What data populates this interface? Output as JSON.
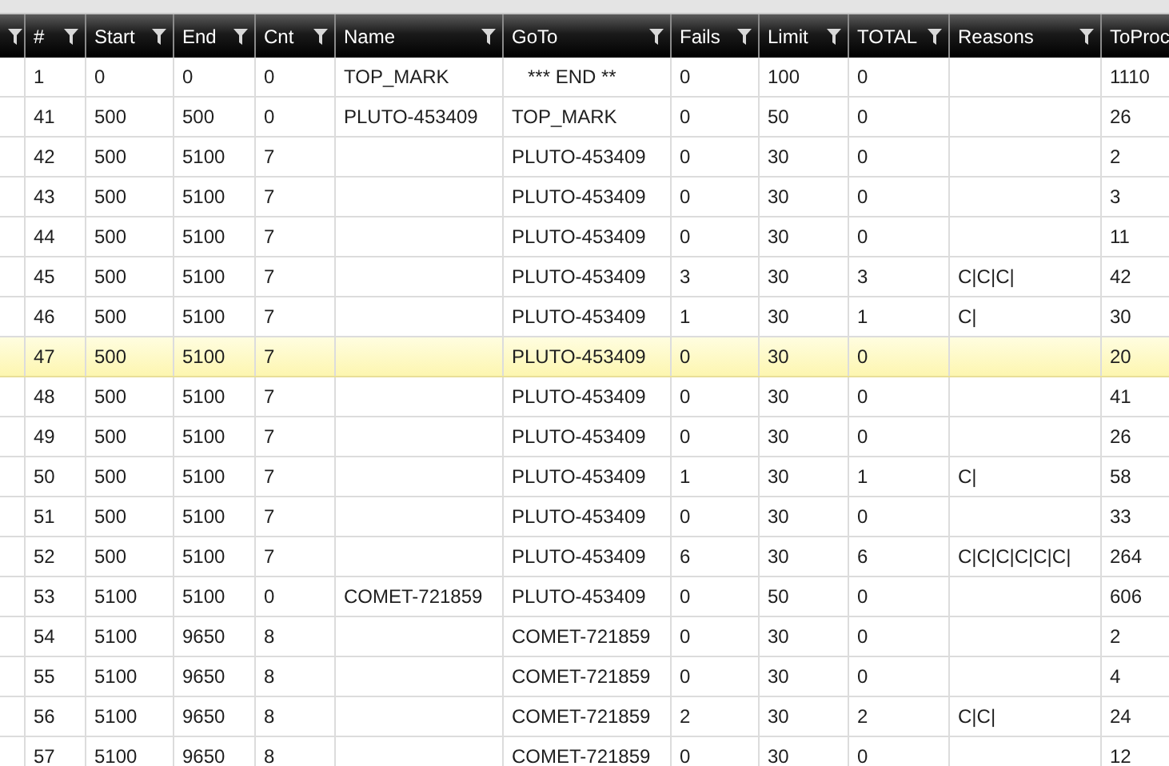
{
  "table": {
    "columns": [
      {
        "filterable": true
      },
      {
        "label": "#",
        "filterable": true
      },
      {
        "label": "Start",
        "filterable": true
      },
      {
        "label": "End",
        "filterable": true
      },
      {
        "label": "Cnt",
        "filterable": true
      },
      {
        "label": "Name",
        "filterable": true
      },
      {
        "label": "GoTo",
        "filterable": true
      },
      {
        "label": "Fails",
        "filterable": true
      },
      {
        "label": "Limit",
        "filterable": true
      },
      {
        "label": "TOTAL",
        "filterable": true
      },
      {
        "label": "Reasons",
        "filterable": true
      },
      {
        "label": "ToProc"
      }
    ],
    "rows": [
      {
        "selected": false,
        "cells": [
          null,
          "1",
          "0",
          "0",
          "0",
          "TOP_MARK",
          "   *** END **",
          "0",
          "100",
          "0",
          null,
          "1110"
        ]
      },
      {
        "selected": false,
        "cells": [
          null,
          "41",
          "500",
          "500",
          "0",
          "PLUTO-453409",
          "TOP_MARK",
          "0",
          "50",
          "0",
          null,
          "26"
        ]
      },
      {
        "selected": false,
        "cells": [
          null,
          "42",
          "500",
          "5100",
          "7",
          null,
          "PLUTO-453409",
          "0",
          "30",
          "0",
          null,
          "2"
        ]
      },
      {
        "selected": false,
        "cells": [
          null,
          "43",
          "500",
          "5100",
          "7",
          null,
          "PLUTO-453409",
          "0",
          "30",
          "0",
          null,
          "3"
        ]
      },
      {
        "selected": false,
        "cells": [
          null,
          "44",
          "500",
          "5100",
          "7",
          null,
          "PLUTO-453409",
          "0",
          "30",
          "0",
          null,
          "11"
        ]
      },
      {
        "selected": false,
        "cells": [
          null,
          "45",
          "500",
          "5100",
          "7",
          null,
          "PLUTO-453409",
          "3",
          "30",
          "3",
          "C|C|C|",
          "42"
        ]
      },
      {
        "selected": false,
        "cells": [
          null,
          "46",
          "500",
          "5100",
          "7",
          null,
          "PLUTO-453409",
          "1",
          "30",
          "1",
          "C|",
          "30"
        ]
      },
      {
        "selected": true,
        "cells": [
          null,
          "47",
          "500",
          "5100",
          "7",
          null,
          "PLUTO-453409",
          "0",
          "30",
          "0",
          null,
          "20"
        ]
      },
      {
        "selected": false,
        "cells": [
          null,
          "48",
          "500",
          "5100",
          "7",
          null,
          "PLUTO-453409",
          "0",
          "30",
          "0",
          null,
          "41"
        ]
      },
      {
        "selected": false,
        "cells": [
          null,
          "49",
          "500",
          "5100",
          "7",
          null,
          "PLUTO-453409",
          "0",
          "30",
          "0",
          null,
          "26"
        ]
      },
      {
        "selected": false,
        "cells": [
          null,
          "50",
          "500",
          "5100",
          "7",
          null,
          "PLUTO-453409",
          "1",
          "30",
          "1",
          "C|",
          "58"
        ]
      },
      {
        "selected": false,
        "cells": [
          null,
          "51",
          "500",
          "5100",
          "7",
          null,
          "PLUTO-453409",
          "0",
          "30",
          "0",
          null,
          "33"
        ]
      },
      {
        "selected": false,
        "cells": [
          null,
          "52",
          "500",
          "5100",
          "7",
          null,
          "PLUTO-453409",
          "6",
          "30",
          "6",
          "C|C|C|C|C|C|",
          "264"
        ]
      },
      {
        "selected": false,
        "cells": [
          null,
          "53",
          "5100",
          "5100",
          "0",
          "COMET-721859",
          "PLUTO-453409",
          "0",
          "50",
          "0",
          null,
          "606"
        ]
      },
      {
        "selected": false,
        "cells": [
          null,
          "54",
          "5100",
          "9650",
          "8",
          null,
          "COMET-721859",
          "0",
          "30",
          "0",
          null,
          "2"
        ]
      },
      {
        "selected": false,
        "cells": [
          null,
          "55",
          "5100",
          "9650",
          "8",
          null,
          "COMET-721859",
          "0",
          "30",
          "0",
          null,
          "4"
        ]
      },
      {
        "selected": false,
        "cells": [
          null,
          "56",
          "5100",
          "9650",
          "8",
          null,
          "COMET-721859",
          "2",
          "30",
          "2",
          "C|C|",
          "24"
        ]
      },
      {
        "selected": false,
        "cells": [
          null,
          "57",
          "5100",
          "9650",
          "8",
          null,
          "COMET-721859",
          "0",
          "30",
          "0",
          null,
          "12"
        ]
      }
    ]
  }
}
